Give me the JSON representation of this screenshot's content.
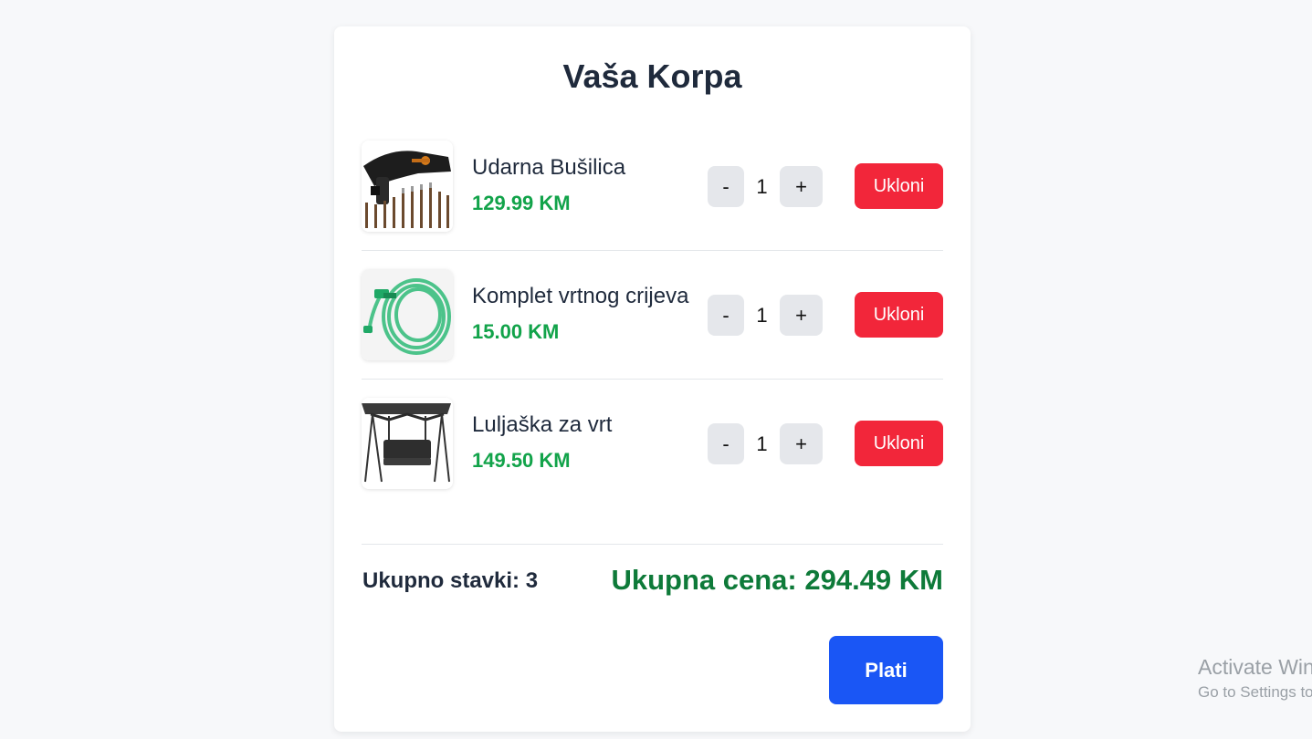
{
  "cart": {
    "title": "Vaša Korpa",
    "items": [
      {
        "name": "Udarna Bušilica",
        "price": "129.99 KM",
        "quantity": "1",
        "minus_label": "-",
        "plus_label": "+",
        "remove_label": "Ukloni",
        "image": "hammer-drill-with-bits"
      },
      {
        "name": "Komplet vrtnog crijeva",
        "price": "15.00 KM",
        "quantity": "1",
        "minus_label": "-",
        "plus_label": "+",
        "remove_label": "Ukloni",
        "image": "green-garden-hose-coil"
      },
      {
        "name": "Luljaška za vrt",
        "price": "149.50 KM",
        "quantity": "1",
        "minus_label": "-",
        "plus_label": "+",
        "remove_label": "Ukloni",
        "image": "garden-swing-with-canopy"
      }
    ],
    "summary": {
      "total_items": "Ukupno stavki: 3",
      "total_price": "Ukupna cena: 294.49 KM"
    },
    "pay_label": "Plati"
  },
  "watermark": {
    "title": "Activate Windows",
    "subtitle": "Go to Settings to activate Windows."
  },
  "colors": {
    "page_background": "#f7f8fa",
    "card": "#ffffff",
    "price_green": "#12a34a",
    "total_green": "#0e7a39",
    "remove_red": "#f2263a",
    "pay_blue": "#1a56f5",
    "qty_button_gray": "#e5e7eb"
  }
}
